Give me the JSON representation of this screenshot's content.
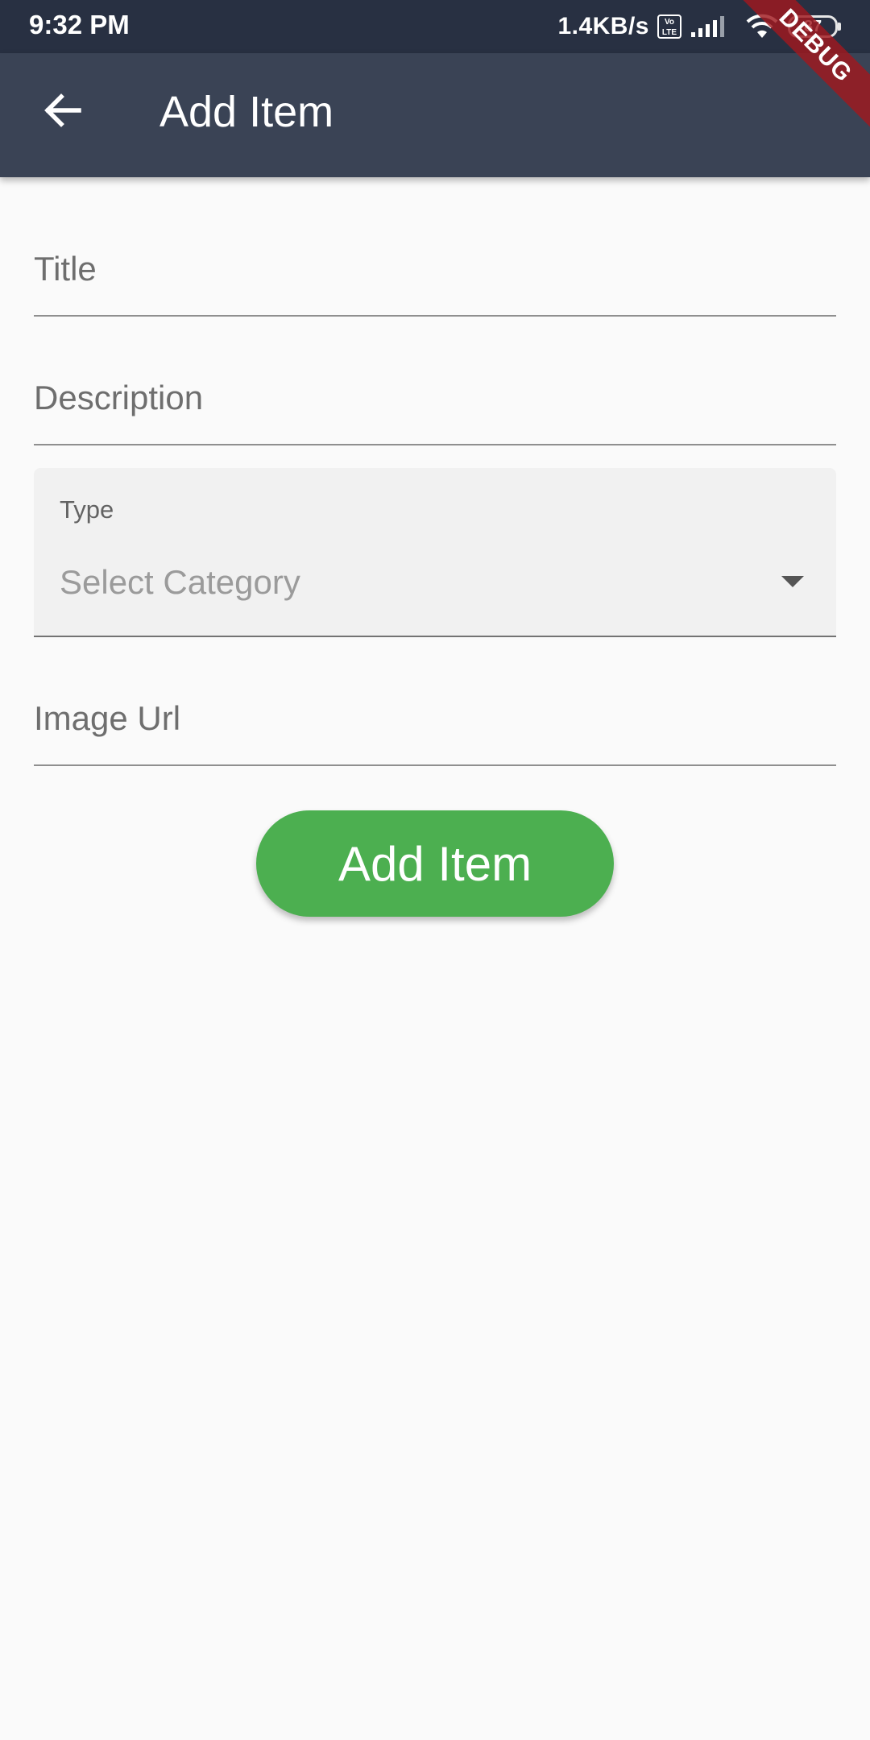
{
  "status_bar": {
    "time": "9:32 PM",
    "net_speed": "1.4KB/s",
    "volte_top": "Vo",
    "volte_bottom": "LTE",
    "battery_level": "87",
    "icons": [
      "volte-icon",
      "signal-icon",
      "wifi-icon",
      "battery-icon"
    ]
  },
  "debug_banner": "DEBUG",
  "app_bar": {
    "title": "Add Item",
    "back_icon": "arrow-back-icon"
  },
  "form": {
    "title_placeholder": "Title",
    "title_value": "",
    "description_placeholder": "Description",
    "description_value": "",
    "type_label": "Type",
    "type_placeholder": "Select Category",
    "image_url_placeholder": "Image Url",
    "image_url_value": "",
    "submit_label": "Add Item"
  },
  "colors": {
    "app_bar": "#3a4355",
    "status_bar": "#283042",
    "button": "#4caf50",
    "background": "#fafafa"
  }
}
